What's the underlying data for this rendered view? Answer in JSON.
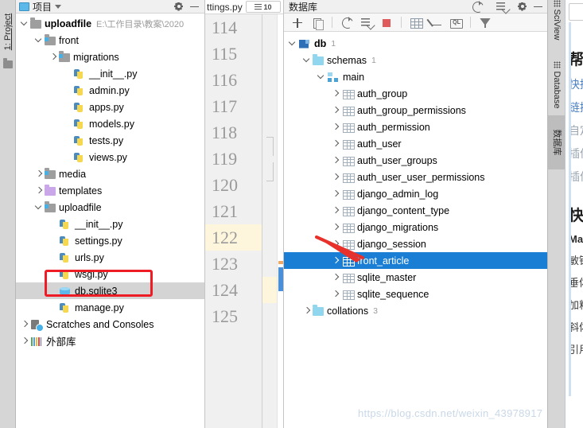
{
  "colors": {
    "selection_blue": "#1a7fd4",
    "highlight_red": "#ee1c25",
    "gutter_highlight": "#fdf6dd",
    "project_selected_gray": "#d4d4d4",
    "watermark": "#c9d8e8"
  },
  "left_strip": {
    "tab_label": "1: Project",
    "folder_icon": "folder-icon"
  },
  "project_panel": {
    "header": {
      "title": "项目",
      "dropdown_icon": "chevron-down-icon",
      "panel_icon": "project-panel-icon",
      "settings_icon": "gear-icon",
      "minimize_icon": "minimize-icon"
    },
    "tree": [
      {
        "label": "uploadfile",
        "path": "E:\\工作目录\\教案\\2020",
        "icon": "folder-icon",
        "twist": "down",
        "indent": 0,
        "bold": true,
        "selected": false
      },
      {
        "label": "front",
        "path": "",
        "icon": "module-folder-icon",
        "twist": "down",
        "indent": 1,
        "bold": false,
        "selected": false
      },
      {
        "label": "migrations",
        "path": "",
        "icon": "module-folder-icon",
        "twist": "right",
        "indent": 2,
        "bold": false,
        "selected": false
      },
      {
        "label": "__init__.py",
        "path": "",
        "icon": "python-file-icon",
        "twist": "none",
        "indent": 3,
        "bold": false,
        "selected": false
      },
      {
        "label": "admin.py",
        "path": "",
        "icon": "python-file-icon",
        "twist": "none",
        "indent": 3,
        "bold": false,
        "selected": false
      },
      {
        "label": "apps.py",
        "path": "",
        "icon": "python-file-icon",
        "twist": "none",
        "indent": 3,
        "bold": false,
        "selected": false
      },
      {
        "label": "models.py",
        "path": "",
        "icon": "python-file-icon",
        "twist": "none",
        "indent": 3,
        "bold": false,
        "selected": false
      },
      {
        "label": "tests.py",
        "path": "",
        "icon": "python-file-icon",
        "twist": "none",
        "indent": 3,
        "bold": false,
        "selected": false
      },
      {
        "label": "views.py",
        "path": "",
        "icon": "python-file-icon",
        "twist": "none",
        "indent": 3,
        "bold": false,
        "selected": false
      },
      {
        "label": "media",
        "path": "",
        "icon": "module-folder-icon",
        "twist": "right",
        "indent": 1,
        "bold": false,
        "selected": false
      },
      {
        "label": "templates",
        "path": "",
        "icon": "templates-folder-icon",
        "twist": "right",
        "indent": 1,
        "bold": false,
        "selected": false
      },
      {
        "label": "uploadfile",
        "path": "",
        "icon": "module-folder-icon",
        "twist": "down",
        "indent": 1,
        "bold": false,
        "selected": false
      },
      {
        "label": "__init__.py",
        "path": "",
        "icon": "python-file-icon",
        "twist": "none",
        "indent": 2,
        "bold": false,
        "selected": false
      },
      {
        "label": "settings.py",
        "path": "",
        "icon": "python-file-icon",
        "twist": "none",
        "indent": 2,
        "bold": false,
        "selected": false
      },
      {
        "label": "urls.py",
        "path": "",
        "icon": "python-file-icon",
        "twist": "none",
        "indent": 2,
        "bold": false,
        "selected": false
      },
      {
        "label": "wsgi.py",
        "path": "",
        "icon": "python-file-icon",
        "twist": "none",
        "indent": 2,
        "bold": false,
        "selected": false
      },
      {
        "label": "db.sqlite3",
        "path": "",
        "icon": "sqlite-db-icon",
        "twist": "none",
        "indent": 2,
        "bold": false,
        "selected": true
      },
      {
        "label": "manage.py",
        "path": "",
        "icon": "python-file-icon",
        "twist": "none",
        "indent": 2,
        "bold": false,
        "selected": false
      },
      {
        "label": "Scratches and Consoles",
        "path": "",
        "icon": "scratches-icon",
        "twist": "right",
        "indent": 0,
        "bold": false,
        "selected": false
      },
      {
        "label": "外部库",
        "path": "",
        "icon": "external-libraries-icon",
        "twist": "right",
        "indent": 0,
        "bold": false,
        "selected": false
      }
    ]
  },
  "editor": {
    "tab_label": "ttings.py",
    "tab_close_icon": "close-icon",
    "line_chip": "10",
    "line_numbers": [
      "114",
      "115",
      "116",
      "117",
      "118",
      "119",
      "120",
      "121",
      "122",
      "123",
      "124",
      "125"
    ],
    "highlighted_line": "122"
  },
  "db_panel": {
    "header": {
      "title": "数据库",
      "settings_icon": "gear-icon",
      "minimize_icon": "minimize-icon",
      "help_icon": "help-circle-icon",
      "collapse_icon": "collapse-all-icon"
    },
    "toolbar": [
      {
        "name": "add-data-source-button",
        "icon": "plus-icon"
      },
      {
        "name": "duplicate-button",
        "icon": "copy-icon"
      },
      {
        "name": "refresh-button",
        "icon": "refresh-icon"
      },
      {
        "name": "synchronize-button",
        "icon": "sync-icon"
      },
      {
        "name": "stop-button",
        "icon": "stop-icon"
      },
      {
        "name": "open-table-editor-button",
        "icon": "table-icon"
      },
      {
        "name": "modify-button",
        "icon": "pencil-icon"
      },
      {
        "name": "query-console-button",
        "icon": "ql-icon"
      },
      {
        "name": "filter-button",
        "icon": "filter-icon"
      }
    ],
    "tree": [
      {
        "label": "db",
        "count": "1",
        "icon": "database-icon",
        "twist": "down",
        "indent": 0,
        "bold": true,
        "selected": false
      },
      {
        "label": "schemas",
        "count": "1",
        "icon": "folder-cyan-icon",
        "twist": "down",
        "indent": 1,
        "bold": false,
        "selected": false
      },
      {
        "label": "main",
        "count": "",
        "icon": "schema-icon",
        "twist": "down",
        "indent": 2,
        "bold": false,
        "selected": false
      },
      {
        "label": "auth_group",
        "count": "",
        "icon": "table-icon",
        "twist": "right",
        "indent": 3,
        "bold": false,
        "selected": false
      },
      {
        "label": "auth_group_permissions",
        "count": "",
        "icon": "table-icon",
        "twist": "right",
        "indent": 3,
        "bold": false,
        "selected": false
      },
      {
        "label": "auth_permission",
        "count": "",
        "icon": "table-icon",
        "twist": "right",
        "indent": 3,
        "bold": false,
        "selected": false
      },
      {
        "label": "auth_user",
        "count": "",
        "icon": "table-icon",
        "twist": "right",
        "indent": 3,
        "bold": false,
        "selected": false
      },
      {
        "label": "auth_user_groups",
        "count": "",
        "icon": "table-icon",
        "twist": "right",
        "indent": 3,
        "bold": false,
        "selected": false
      },
      {
        "label": "auth_user_user_permissions",
        "count": "",
        "icon": "table-icon",
        "twist": "right",
        "indent": 3,
        "bold": false,
        "selected": false
      },
      {
        "label": "django_admin_log",
        "count": "",
        "icon": "table-icon",
        "twist": "right",
        "indent": 3,
        "bold": false,
        "selected": false
      },
      {
        "label": "django_content_type",
        "count": "",
        "icon": "table-icon",
        "twist": "right",
        "indent": 3,
        "bold": false,
        "selected": false
      },
      {
        "label": "django_migrations",
        "count": "",
        "icon": "table-icon",
        "twist": "right",
        "indent": 3,
        "bold": false,
        "selected": false
      },
      {
        "label": "django_session",
        "count": "",
        "icon": "table-icon",
        "twist": "right",
        "indent": 3,
        "bold": false,
        "selected": false
      },
      {
        "label": "front_article",
        "count": "",
        "icon": "table-icon",
        "twist": "right",
        "indent": 3,
        "bold": false,
        "selected": true
      },
      {
        "label": "sqlite_master",
        "count": "",
        "icon": "table-icon",
        "twist": "right",
        "indent": 3,
        "bold": false,
        "selected": false
      },
      {
        "label": "sqlite_sequence",
        "count": "",
        "icon": "table-icon",
        "twist": "right",
        "indent": 3,
        "bold": false,
        "selected": false
      },
      {
        "label": "collations",
        "count": "3",
        "icon": "folder-cyan-icon",
        "twist": "right",
        "indent": 1,
        "bold": false,
        "selected": false
      }
    ]
  },
  "right_strip": {
    "tabs": [
      {
        "label": "SciView",
        "icon": "sciview-icon",
        "active": false
      },
      {
        "label": "Database",
        "icon": "database-icon",
        "active": false
      },
      {
        "label": "数据库",
        "icon": "",
        "active": true
      }
    ]
  },
  "help_panel": {
    "heading": "帮助",
    "links": [
      "快捷键",
      "链接",
      "自定义",
      "插件",
      "插件"
    ],
    "heading2": "快捷",
    "subheading": "Markdown",
    "items": [
      "敏锐",
      "垂体",
      "加粗",
      "斜体",
      "引用"
    ]
  },
  "watermark": "https://blog.csdn.net/weixin_43978917"
}
